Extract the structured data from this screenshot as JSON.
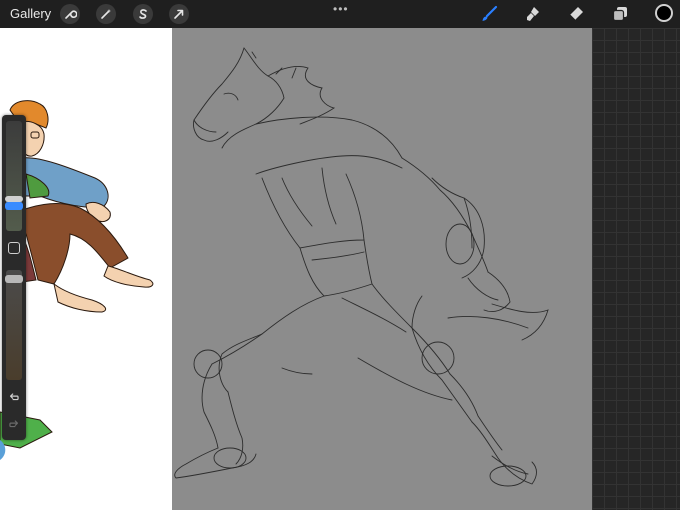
{
  "toolbar": {
    "gallery_label": "Gallery",
    "left_tools": [
      "wrench-icon",
      "magic-wand-icon",
      "selection-s-icon",
      "transform-arrow-icon"
    ],
    "more_dots": "•••",
    "right_tools": [
      "brush-icon",
      "smudge-icon",
      "eraser-icon",
      "layers-icon"
    ],
    "active_tool": "brush-icon",
    "current_color": "#000000",
    "accent_color": "#2a7fff"
  },
  "sidebar": {
    "brush_size_slider": "size",
    "opacity_slider": "opacity",
    "controls": [
      "modify-square-icon",
      "undo-icon",
      "redo-icon"
    ]
  }
}
